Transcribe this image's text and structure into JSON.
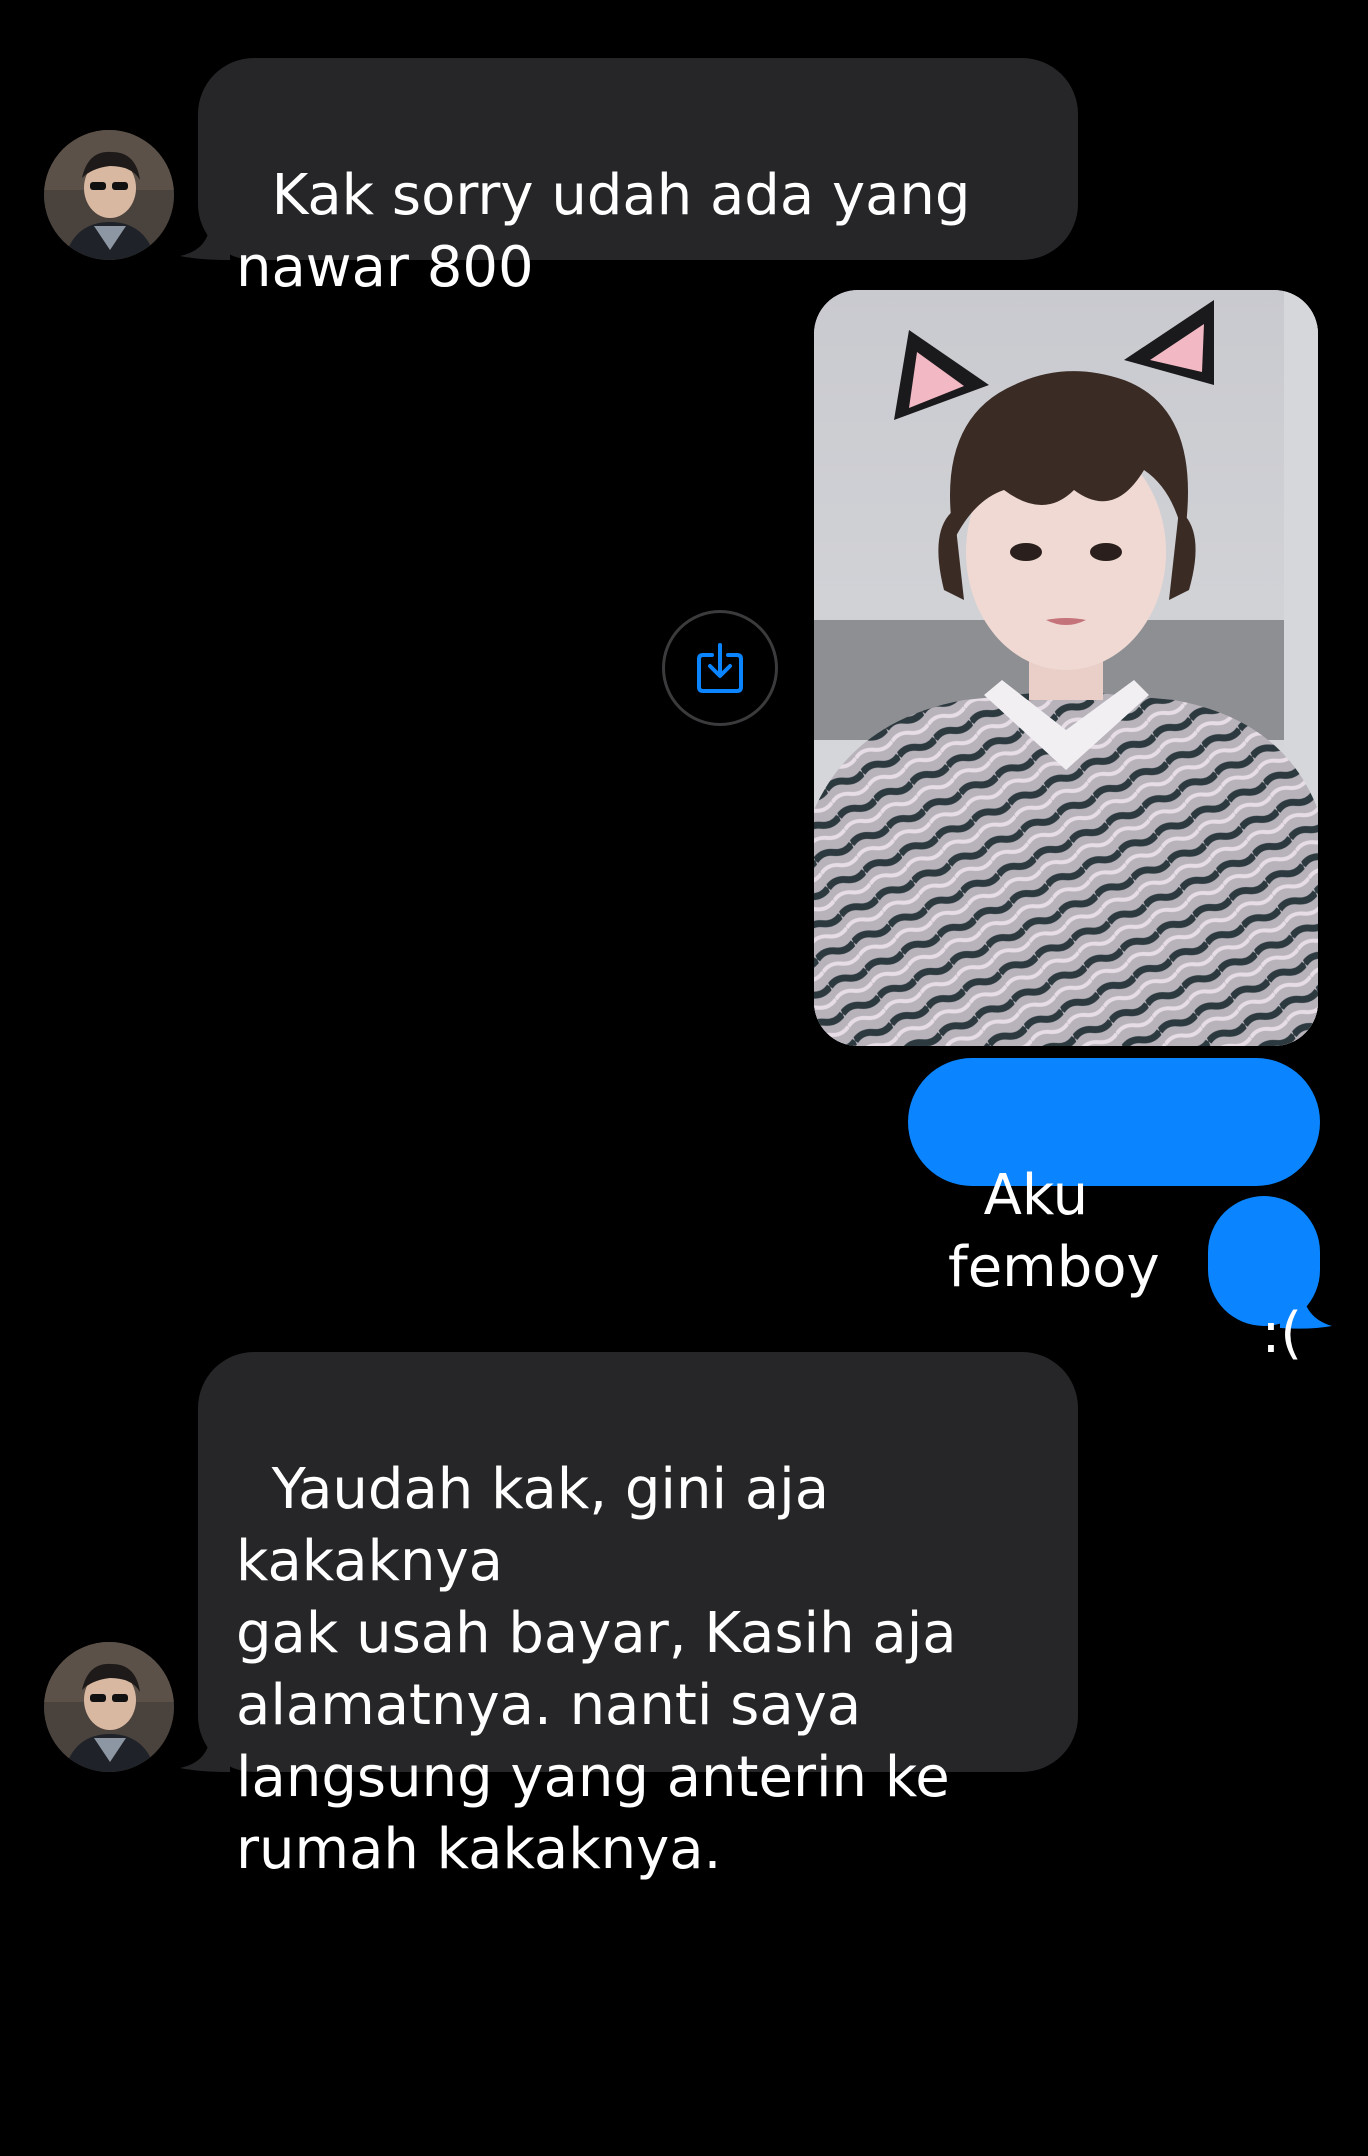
{
  "conversation": {
    "messages": [
      {
        "sender": "contact",
        "text": "Kak sorry udah ada yang\nnawar 800"
      },
      {
        "sender": "me",
        "type": "image",
        "description_icon": "download-icon"
      },
      {
        "sender": "me",
        "text": "Aku femboy"
      },
      {
        "sender": "me",
        "text": ":("
      },
      {
        "sender": "contact",
        "text": "Yaudah kak, gini aja kakaknya\ngak usah bayar, Kasih aja\nalamatnya. nanti saya\nlangsung yang anterin ke\nrumah kakaknya."
      }
    ]
  },
  "colors": {
    "background": "#000000",
    "incoming_bubble": "#262628",
    "outgoing_bubble": "#0a84ff",
    "text": "#ffffff",
    "accent": "#0a84ff"
  }
}
